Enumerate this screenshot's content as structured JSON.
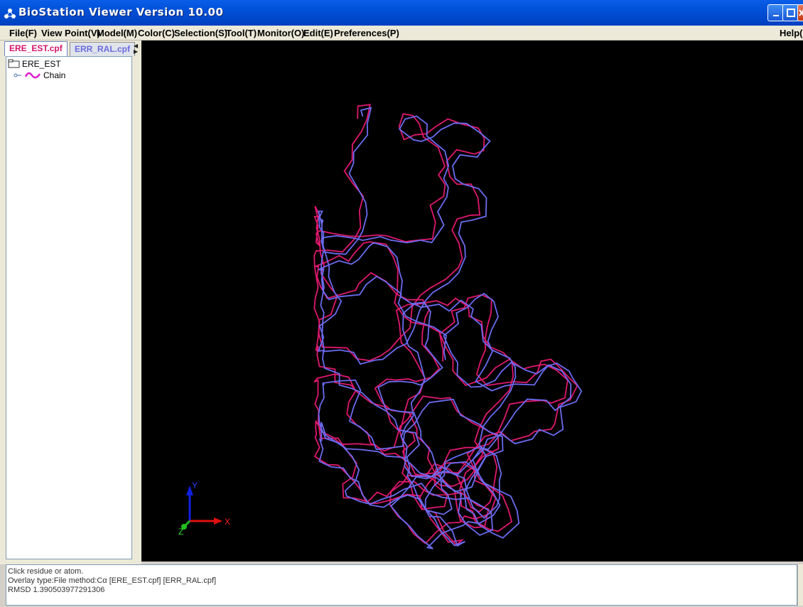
{
  "window": {
    "title": "BioStation Viewer Version 10.00"
  },
  "menu": [
    {
      "label": "File(F)",
      "key": "F"
    },
    {
      "label": "View Point(V)",
      "key": "V"
    },
    {
      "label": "Model(M)",
      "key": "M"
    },
    {
      "label": "Color(C)",
      "key": "C"
    },
    {
      "label": "Selection(S)",
      "key": "S"
    },
    {
      "label": "Tool(T)",
      "key": "T"
    },
    {
      "label": "Monitor(O)",
      "key": "O"
    },
    {
      "label": "Edit(E)",
      "key": "E"
    },
    {
      "label": "Preferences(P)",
      "key": "P"
    },
    {
      "label": "Help(H)",
      "key": "H"
    }
  ],
  "tabs": [
    {
      "label": "ERE_EST.cpf",
      "active": true
    },
    {
      "label": "ERR_RAL.cpf",
      "active": false
    }
  ],
  "tree": {
    "root": "ERE_EST",
    "child": "Chain"
  },
  "axes": {
    "x": "X",
    "y": "Y",
    "z": "Z"
  },
  "colors": {
    "structure_a": "#e0186e",
    "structure_b": "#6b6bf0",
    "axis_x": "#e01010",
    "axis_y": "#1020e0",
    "axis_z": "#20c020"
  },
  "console": {
    "lines": [
      "Click residue or atom.",
      "Overlay type:File method:Cα [ERE_EST.cpf] [ERR_RAL.cpf]",
      "RMSD 1.390503977291306"
    ]
  }
}
